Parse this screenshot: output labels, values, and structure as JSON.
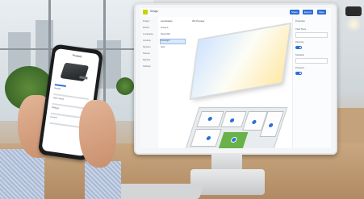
{
  "app": {
    "name": "Design",
    "top_buttons": [
      "Share",
      "Export",
      "Save"
    ]
  },
  "sidebar": {
    "items": [
      "Project",
      "Rooms",
      "Luminaires",
      "Controls",
      "Sensors",
      "Scenes",
      "Reports",
      "Settings"
    ]
  },
  "panel": {
    "title": "Luminaires",
    "rows": [
      "Group A",
      "Panel 600",
      "Downlight",
      "Spot"
    ]
  },
  "main": {
    "label": "3D Preview"
  },
  "right_pane": {
    "rows": [
      "Properties",
      "Color Temp",
      "Dimming",
      "Schedule",
      "Presence"
    ]
  },
  "phone": {
    "title": "Product",
    "rows": [
      "Details",
      "Light output",
      "Wattage",
      "Control"
    ]
  },
  "colors": {
    "accent": "#2f6fd6",
    "brand": "#c8d400",
    "floor_green": "#69b24a"
  },
  "icons": [
    "logo-chip",
    "location-marker-icon",
    "toggle-switch"
  ]
}
